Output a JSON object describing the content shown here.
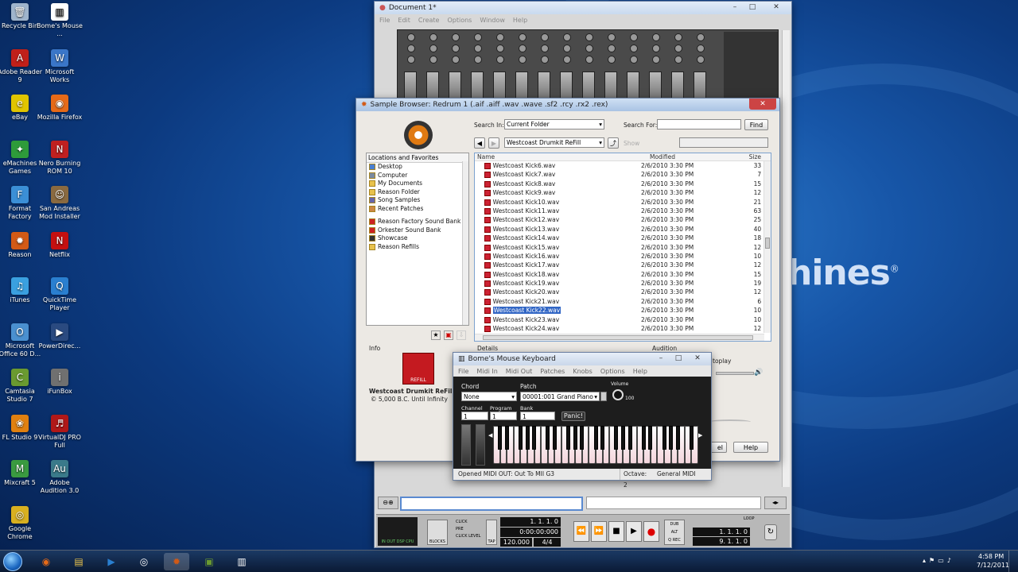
{
  "desktop": {
    "brand": "hines",
    "icons": [
      {
        "label": "Recycle Bin",
        "icon": "recycle-bin-icon",
        "color": "#9fb4cc"
      },
      {
        "label": "Bome's Mouse ...",
        "icon": "piano-keys-icon",
        "color": "#ffffff"
      },
      {
        "label": "Adobe Reader 9",
        "icon": "adobe-reader-icon",
        "color": "#c0201a"
      },
      {
        "label": "Microsoft Works",
        "icon": "ms-works-icon",
        "color": "#3a76c8"
      },
      {
        "label": "eBay",
        "icon": "ebay-icon",
        "color": "#e0c400"
      },
      {
        "label": "Mozilla Firefox",
        "icon": "firefox-icon",
        "color": "#e66a18"
      },
      {
        "label": "eMachines Games",
        "icon": "games-icon",
        "color": "#2e9b3a"
      },
      {
        "label": "Nero Burning ROM 10",
        "icon": "nero-icon",
        "color": "#c02020"
      },
      {
        "label": "Format Factory",
        "icon": "format-factory-icon",
        "color": "#3b8fd6"
      },
      {
        "label": "San Andreas Mod Installer",
        "icon": "san-andreas-icon",
        "color": "#8a6a40"
      },
      {
        "label": "Reason",
        "icon": "reason-icon",
        "color": "#d25a16"
      },
      {
        "label": "Netflix",
        "icon": "netflix-icon",
        "color": "#c51010"
      },
      {
        "label": "iTunes",
        "icon": "itunes-icon",
        "color": "#3aa0e0"
      },
      {
        "label": "QuickTime Player",
        "icon": "quicktime-icon",
        "color": "#2a7fd0"
      },
      {
        "label": "Microsoft Office 60 D...",
        "icon": "ms-office-icon",
        "color": "#4a90d0"
      },
      {
        "label": "PowerDirec...",
        "icon": "powerdirector-icon",
        "color": "#2a4a80"
      },
      {
        "label": "Camtasia Studio 7",
        "icon": "camtasia-icon",
        "color": "#6a9a30"
      },
      {
        "label": "iFunBox",
        "icon": "ifunbox-icon",
        "color": "#707070"
      },
      {
        "label": "FL Studio 9",
        "icon": "fl-studio-icon",
        "color": "#e08010"
      },
      {
        "label": "VirtualDJ PRO Full",
        "icon": "virtualdj-icon",
        "color": "#b01818"
      },
      {
        "label": "Mixcraft 5",
        "icon": "mixcraft-icon",
        "color": "#3a9a40"
      },
      {
        "label": "Adobe Audition 3.0",
        "icon": "adobe-audition-icon",
        "color": "#3a7a8a"
      },
      {
        "label": "Google Chrome",
        "icon": "chrome-icon",
        "color": "#d8b020"
      }
    ]
  },
  "reason_window": {
    "title": "Document 1*",
    "menu": [
      "File",
      "Edit",
      "Create",
      "Options",
      "Window",
      "Help"
    ],
    "transport": {
      "position": "1. 1. 1. 0",
      "time": "0:00:00:000",
      "tempo": "120.000",
      "signature": "4/4",
      "loop_left": "1. 1. 1. 0",
      "loop_right": "9. 1. 1. 0",
      "labels": {
        "click": "CLICK",
        "pre": "PRE",
        "click_level": "CLICK LEVEL",
        "tap": "TAP",
        "blocks": "BLOCKS",
        "loop": "LOOP",
        "dub": "DUB",
        "alt": "ALT",
        "qrec": "Q REC",
        "inout": "IN OUT DSP CPU"
      }
    }
  },
  "sample_browser": {
    "title": "Sample Browser: Redrum 1 (.aif .aiff .wav .wave .sf2 .rcy .rx2 .rex)",
    "search_in_label": "Search In:",
    "search_in_value": "Current Folder",
    "search_for_label": "Search For:",
    "search_for_value": "",
    "find_button": "Find",
    "path_value": "Westcoast Drumkit ReFill",
    "show_label": "Show",
    "locations_header": "Locations and Favorites",
    "locations": [
      {
        "label": "Desktop",
        "icon": "desktop-icon"
      },
      {
        "label": "Computer",
        "icon": "computer-icon"
      },
      {
        "label": "My Documents",
        "icon": "folder-icon"
      },
      {
        "label": "Reason Folder",
        "icon": "folder-icon"
      },
      {
        "label": "Song Samples",
        "icon": "song-samples-icon"
      },
      {
        "label": "Recent Patches",
        "icon": "recent-patches-icon"
      }
    ],
    "favorites": [
      {
        "label": "Reason Factory Sound Bank",
        "icon": "refill-icon"
      },
      {
        "label": "Orkester Sound Bank",
        "icon": "refill-icon"
      },
      {
        "label": "Showcase",
        "icon": "star-icon"
      },
      {
        "label": "Reason Refills",
        "icon": "folder-icon"
      }
    ],
    "columns": {
      "name": "Name",
      "modified": "Modified",
      "size": "Size"
    },
    "files": [
      {
        "name": "Westcoast Kick6.wav",
        "modified": "2/6/2010 3:30 PM",
        "size": "33 kB"
      },
      {
        "name": "Westcoast Kick7.wav",
        "modified": "2/6/2010 3:30 PM",
        "size": "7 kB"
      },
      {
        "name": "Westcoast Kick8.wav",
        "modified": "2/6/2010 3:30 PM",
        "size": "15 kB"
      },
      {
        "name": "Westcoast Kick9.wav",
        "modified": "2/6/2010 3:30 PM",
        "size": "12 kB"
      },
      {
        "name": "Westcoast Kick10.wav",
        "modified": "2/6/2010 3:30 PM",
        "size": "21 kB"
      },
      {
        "name": "Westcoast Kick11.wav",
        "modified": "2/6/2010 3:30 PM",
        "size": "63 kB"
      },
      {
        "name": "Westcoast Kick12.wav",
        "modified": "2/6/2010 3:30 PM",
        "size": "25 kB"
      },
      {
        "name": "Westcoast Kick13.wav",
        "modified": "2/6/2010 3:30 PM",
        "size": "40 kB"
      },
      {
        "name": "Westcoast Kick14.wav",
        "modified": "2/6/2010 3:30 PM",
        "size": "18 kB"
      },
      {
        "name": "Westcoast Kick15.wav",
        "modified": "2/6/2010 3:30 PM",
        "size": "12 kB"
      },
      {
        "name": "Westcoast Kick16.wav",
        "modified": "2/6/2010 3:30 PM",
        "size": "10 kB"
      },
      {
        "name": "Westcoast Kick17.wav",
        "modified": "2/6/2010 3:30 PM",
        "size": "12 kB"
      },
      {
        "name": "Westcoast Kick18.wav",
        "modified": "2/6/2010 3:30 PM",
        "size": "15 kB"
      },
      {
        "name": "Westcoast Kick19.wav",
        "modified": "2/6/2010 3:30 PM",
        "size": "19 kB"
      },
      {
        "name": "Westcoast Kick20.wav",
        "modified": "2/6/2010 3:30 PM",
        "size": "12 kB"
      },
      {
        "name": "Westcoast Kick21.wav",
        "modified": "2/6/2010 3:30 PM",
        "size": "6 kB"
      },
      {
        "name": "Westcoast Kick22.wav",
        "modified": "2/6/2010 3:30 PM",
        "size": "10 kB",
        "selected": true
      },
      {
        "name": "Westcoast Kick23.wav",
        "modified": "2/6/2010 3:30 PM",
        "size": "10 kB"
      },
      {
        "name": "Westcoast Kick24.wav",
        "modified": "2/6/2010 3:30 PM",
        "size": "12 kB"
      }
    ],
    "info_label": "Info",
    "details_label": "Details",
    "audition_label": "Audition",
    "autoplay_label": "toplay",
    "refill_name": "Westcoast Drumkit ReFill",
    "refill_author": "© 5,000 B.C. Until Infinity",
    "refill_badge": "REFILL",
    "cancel_button": "el",
    "help_button": "Help"
  },
  "bome": {
    "title": "Bome's Mouse Keyboard",
    "menu": [
      "File",
      "Midi In",
      "Midi Out",
      "Patches",
      "Knobs",
      "Options",
      "Help"
    ],
    "chord_label": "Chord",
    "chord_value": "None",
    "patch_label": "Patch",
    "patch_value": "00001:001 Grand Piano",
    "volume_label": "Volume",
    "volume_value": "100",
    "channel_label": "Channel",
    "channel_value": "1",
    "program_label": "Program",
    "program_value": "1",
    "bank_label": "Bank",
    "bank_value": "1",
    "panic_button": "Panic!",
    "status_left": "Opened MIDI OUT: Out To MII G3",
    "status_octave": "Octave: 2",
    "status_mode": "General MIDI"
  },
  "taskbar": {
    "time": "4:58 PM",
    "date": "7/12/2011",
    "apps": [
      "start-orb-icon",
      "firefox-icon",
      "explorer-icon",
      "media-player-icon",
      "virtualdj-icon",
      "reason-icon",
      "camtasia-icon",
      "piano-keys-icon"
    ]
  }
}
